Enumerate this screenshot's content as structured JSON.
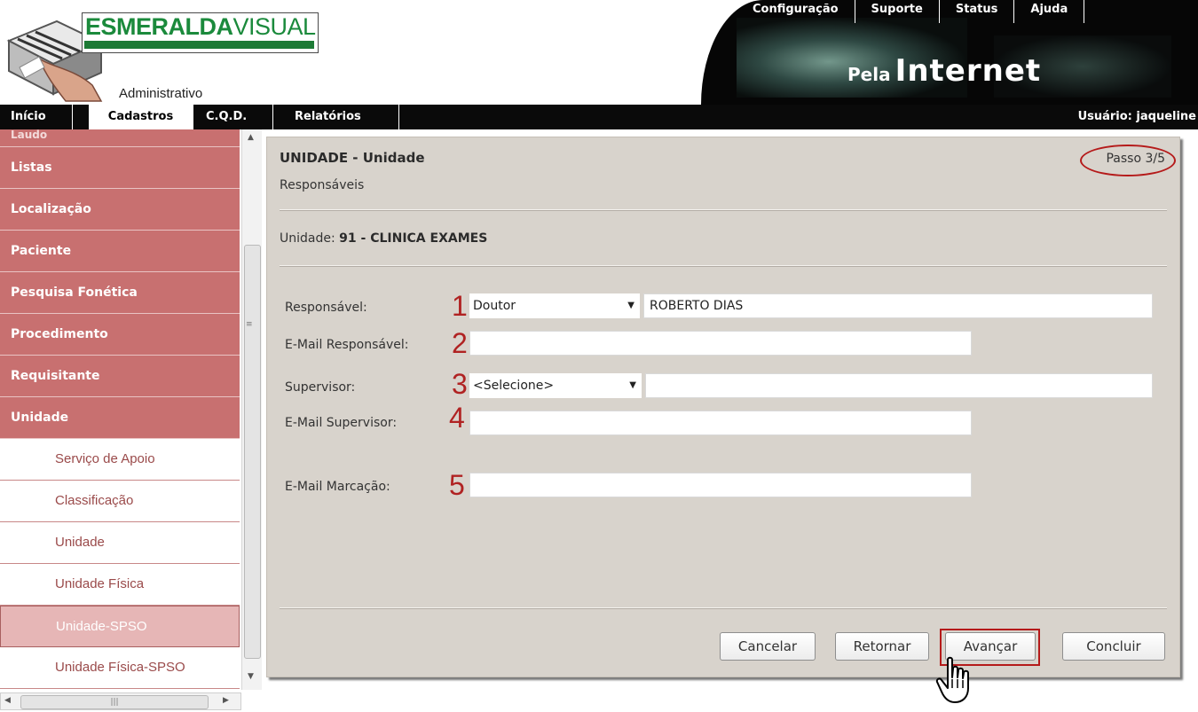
{
  "logo": {
    "brand_part1": "ESMERALDA",
    "brand_part2": "VISUAL",
    "subtitle": "Administrativo"
  },
  "top_links": [
    "Configuração",
    "Suporte",
    "Status",
    "Ajuda"
  ],
  "tagline": {
    "small": "Pela",
    "big": "Internet"
  },
  "main_nav": [
    "Início",
    "Cadastros",
    "C.Q.D.",
    "Relatórios"
  ],
  "main_nav_active": "Cadastros",
  "user": "Usuário: jaqueline",
  "sidebar": {
    "partial_top": "Laudo",
    "groups": [
      "Listas",
      "Localização",
      "Paciente",
      "Pesquisa Fonética",
      "Procedimento",
      "Requisitante",
      "Unidade"
    ],
    "sub_items": [
      "Serviço de Apoio",
      "Classificação",
      "Unidade",
      "Unidade Física",
      "Unidade-SPSO",
      "Unidade Física-SPSO"
    ],
    "selected": "Unidade-SPSO"
  },
  "panel": {
    "title": "UNIDADE - Unidade",
    "subtitle": "Responsáveis",
    "step": "Passo 3/5",
    "unit_label": "Unidade:",
    "unit_value": "91 - CLINICA EXAMES",
    "fields": {
      "responsavel_label": "Responsável:",
      "responsavel_title": "Doutor",
      "responsavel_name": "ROBERTO DIAS",
      "email_responsavel_label": "E-Mail Responsável:",
      "email_responsavel_value": "",
      "supervisor_label": "Supervisor:",
      "supervisor_select": "<Selecione>",
      "supervisor_name": "",
      "email_supervisor_label": "E-Mail Supervisor:",
      "email_supervisor_value": "",
      "email_marcacao_label": "E-Mail Marcação:",
      "email_marcacao_value": ""
    },
    "annotations": [
      "1",
      "2",
      "3",
      "4",
      "5"
    ],
    "buttons": {
      "cancelar": "Cancelar",
      "retornar": "Retornar",
      "avancar": "Avançar",
      "concluir": "Concluir"
    }
  },
  "colors": {
    "sidebar_group": "#c87070",
    "panel_bg": "#d8d3cc",
    "annotation_red": "#b02222",
    "brand_green": "#1b8a3c"
  }
}
